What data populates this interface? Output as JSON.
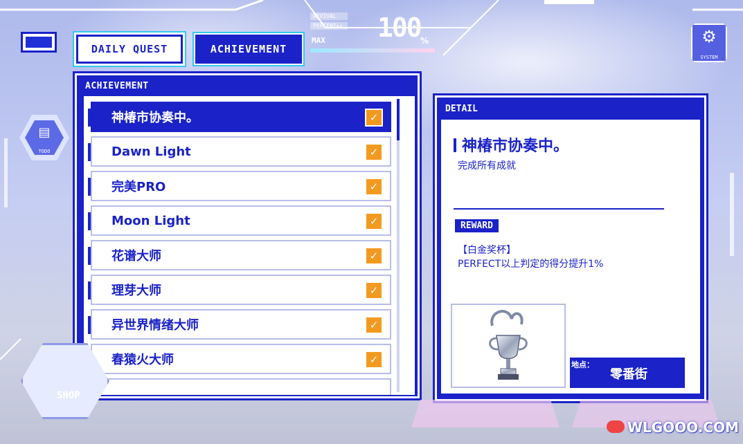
{
  "header": {
    "tabs": [
      {
        "label": "DAILY QUEST",
        "active": false
      },
      {
        "label": "ACHIEVEMENT",
        "active": true
      }
    ],
    "meter": {
      "revival_label": "REVIVAL",
      "percent_label": "PERCENT▸▸",
      "max_label": "MAX",
      "value": "100",
      "unit": "%"
    },
    "system_label": "SYSTEM",
    "todo_label": "TODO"
  },
  "achievement_panel": {
    "title": "ACHIEVEMENT",
    "items": [
      {
        "name": "神椿市协奏中。",
        "selected": true,
        "completed": true
      },
      {
        "name": "Dawn Light",
        "selected": false,
        "completed": true
      },
      {
        "name": "完美PRO",
        "selected": false,
        "completed": true
      },
      {
        "name": "Moon Light",
        "selected": false,
        "completed": true
      },
      {
        "name": "花谱大师",
        "selected": false,
        "completed": true
      },
      {
        "name": "理芽大师",
        "selected": false,
        "completed": true
      },
      {
        "name": "异世界情绪大师",
        "selected": false,
        "completed": true
      },
      {
        "name": "春猿火大师",
        "selected": false,
        "completed": true
      }
    ],
    "check_glyph": "✓"
  },
  "detail_panel": {
    "title": "DETAIL",
    "name": "神椿市协奏中。",
    "description": "完成所有成就",
    "reward_tag": "REWARD",
    "reward_name": "【白金奖杯】",
    "reward_effect": "PERFECT以上判定的得分提升1%",
    "location_label": "地点：",
    "location_value": "零番街"
  },
  "bottom": {
    "shop_label": "SHOP"
  },
  "watermark": "WLGOOO.COM",
  "colors": {
    "primary": "#1a22c8",
    "check": "#f29a1f",
    "accent": "#35c7ee"
  }
}
